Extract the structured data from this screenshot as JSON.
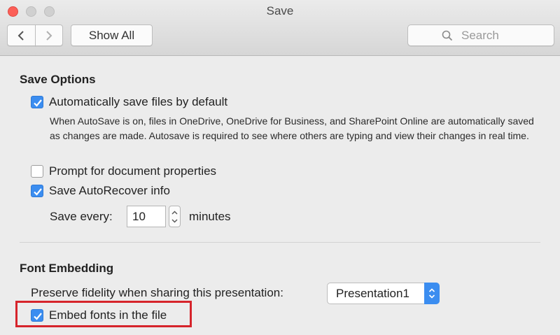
{
  "window": {
    "title": "Save"
  },
  "toolbar": {
    "back_icon": "chevron-left-icon",
    "forward_icon": "chevron-right-icon",
    "show_all_label": "Show All",
    "search_placeholder": "Search",
    "search_icon": "magnifier-icon"
  },
  "save_options": {
    "title": "Save Options",
    "autosave": {
      "label": "Automatically save files by default",
      "checked": true,
      "description": "When AutoSave is on, files in OneDrive, OneDrive for Business, and SharePoint Online are automatically saved as changes are made. Autosave is required to see where others are typing and view their changes in real time."
    },
    "prompt_properties": {
      "label": "Prompt for document properties",
      "checked": false
    },
    "autorecover": {
      "label": "Save AutoRecover info",
      "checked": true
    },
    "save_every": {
      "label": "Save every:",
      "value": "10",
      "unit": "minutes"
    }
  },
  "font_embedding": {
    "title": "Font Embedding",
    "preserve_label": "Preserve fidelity when sharing this presentation:",
    "presentation_select": "Presentation1",
    "embed_fonts": {
      "label": "Embed fonts in the file",
      "checked": true
    }
  },
  "colors": {
    "accent": "#3b8df0",
    "highlight": "#d6242b",
    "close": "#fc5f57"
  }
}
